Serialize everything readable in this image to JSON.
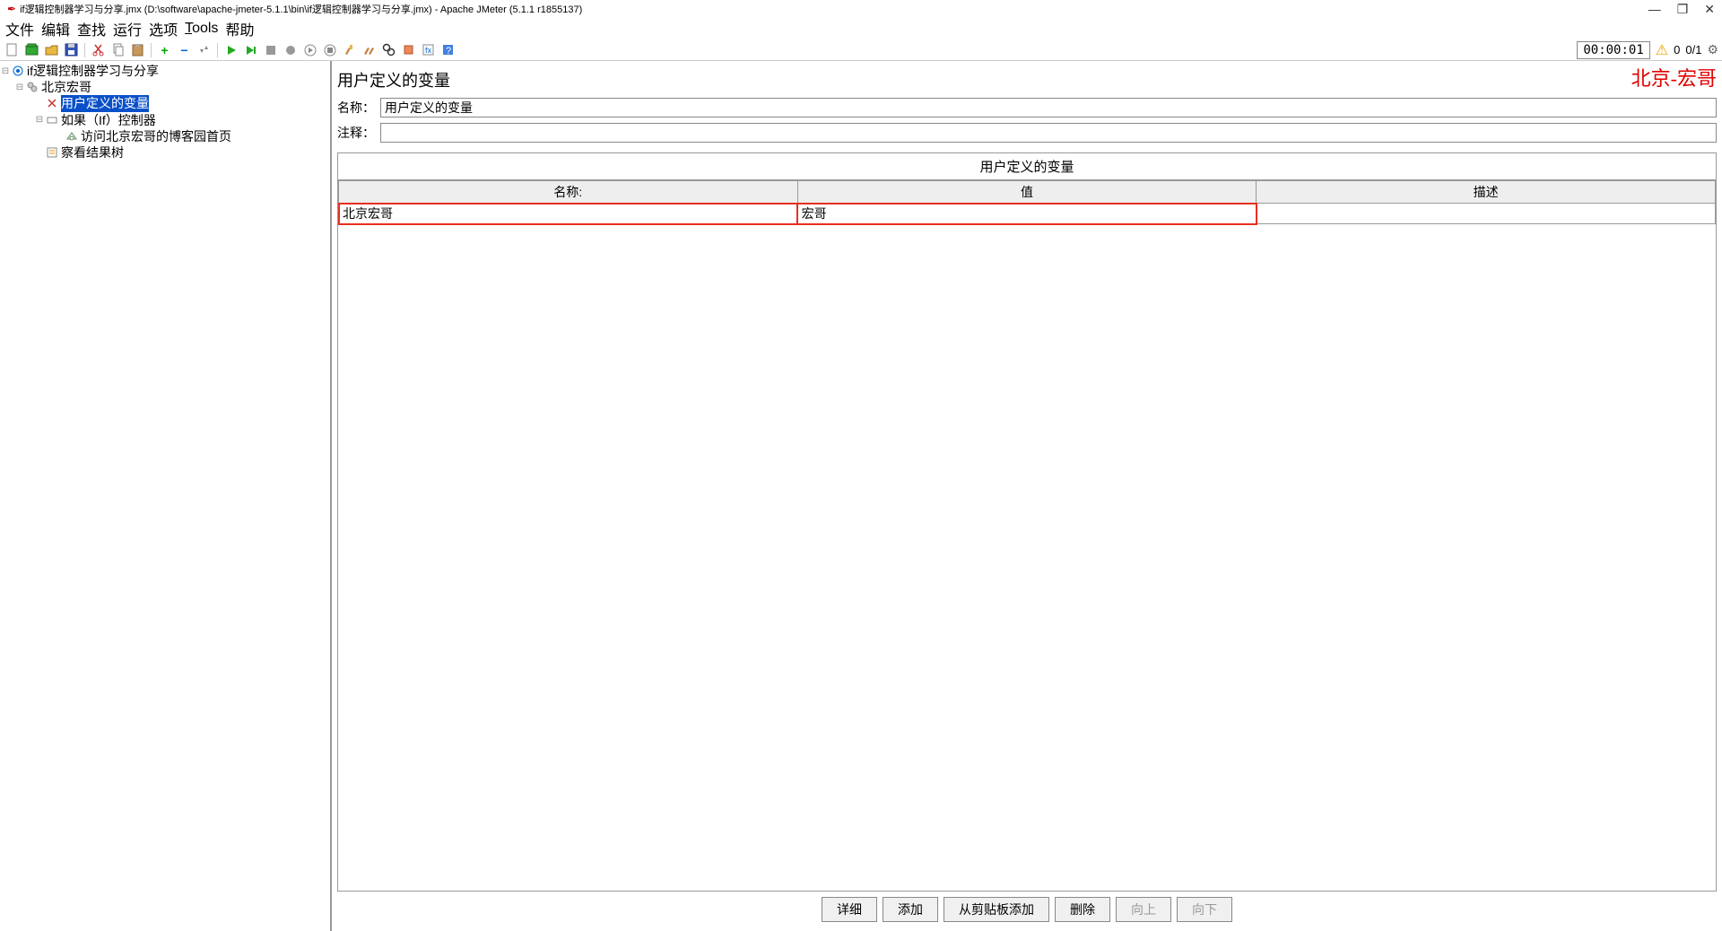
{
  "titlebar": {
    "text": "if逻辑控制器学习与分享.jmx (D:\\software\\apache-jmeter-5.1.1\\bin\\if逻辑控制器学习与分享.jmx) - Apache JMeter (5.1.1 r1855137)",
    "minimize": "—",
    "maximize": "❐",
    "close": "✕"
  },
  "menubar": {
    "file": "文件",
    "edit": "编辑",
    "search": "查找",
    "run": "运行",
    "options": "选项",
    "tools": "Tools",
    "help": "帮助"
  },
  "toolbar": {
    "timer": "00:00:01",
    "warn_count": "0",
    "thread_info": "0/1"
  },
  "tree": {
    "root": "if逻辑控制器学习与分享",
    "thread_group": "北京宏哥",
    "user_vars": "用户定义的变量",
    "if_controller": "如果（If）控制器",
    "http_request": "访问北京宏哥的博客园首页",
    "result_tree": "察看结果树"
  },
  "panel": {
    "title": "用户定义的变量",
    "name_label": "名称：",
    "name_value": "用户定义的变量",
    "comment_label": "注释：",
    "comment_value": "",
    "section_title": "用户定义的变量",
    "col_name": "名称:",
    "col_value": "值",
    "col_desc": "描述",
    "row_name": "北京宏哥",
    "row_value": "宏哥",
    "row_desc": ""
  },
  "buttons": {
    "detail": "详细",
    "add": "添加",
    "clipboard": "从剪贴板添加",
    "delete": "删除",
    "up": "向上",
    "down": "向下"
  },
  "watermark": "北京-宏哥"
}
